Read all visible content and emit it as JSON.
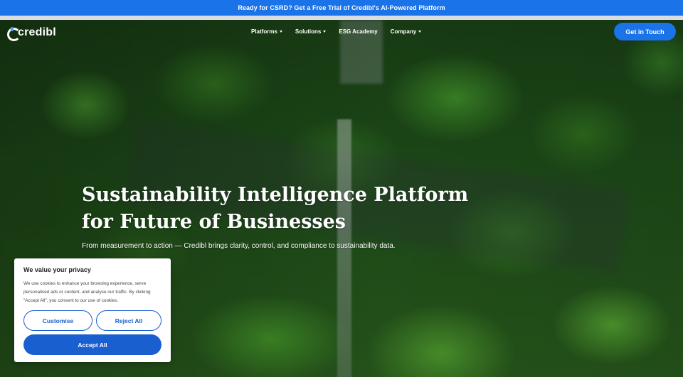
{
  "announcement": {
    "text": "Ready for CSRD? Get a Free Trial of Credibl's AI-Powered Platform"
  },
  "nav": {
    "logo_text": "credibl",
    "items": [
      {
        "label": "Platforms",
        "has_dropdown": true
      },
      {
        "label": "Solutions",
        "has_dropdown": true
      },
      {
        "label": "ESG Academy",
        "has_dropdown": false
      },
      {
        "label": "Company",
        "has_dropdown": true
      }
    ],
    "cta_label": "Get in Touch"
  },
  "hero": {
    "title_line1": "Sustainability Intelligence Platform",
    "title_line2": "for Future of Businesses",
    "subtitle": "From measurement to action — Credibl brings clarity, control, and compliance to sustainability data."
  },
  "cookie_banner": {
    "title": "We value your privacy",
    "text": "We use cookies to enhance your browsing experience, serve personalised ads or content, and analyse our traffic. By clicking \"Accept All\", you consent to our use of cookies.",
    "customise_label": "Customise",
    "reject_label": "Reject All",
    "accept_label": "Accept All"
  },
  "colors": {
    "brand_blue": "#1a73e8",
    "button_blue": "#1a5fd0",
    "hero_green": "#26561b"
  }
}
